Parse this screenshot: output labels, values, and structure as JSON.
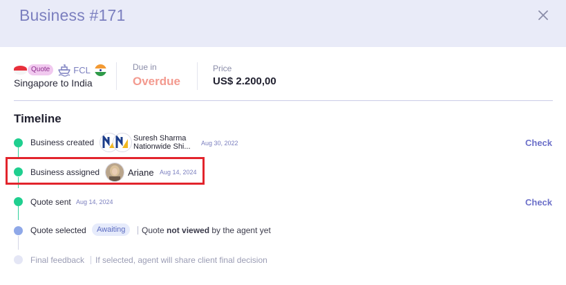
{
  "header": {
    "title": "Business #171"
  },
  "summary": {
    "quote_label": "Quote",
    "mode_label": "FCL",
    "route": "Singapore to India",
    "due_label": "Due in",
    "due_value": "Overdue",
    "price_label": "Price",
    "price_value": "US$ 2.200,00"
  },
  "timeline": {
    "title": "Timeline",
    "steps": [
      {
        "label": "Business created",
        "person_name": "Suresh Sharma",
        "person_company": "Nationwide Shi...",
        "date": "Aug 30, 2022",
        "action": "Check"
      },
      {
        "label": "Business assigned",
        "person_name": "Ariane",
        "date": "Aug 14, 2024"
      },
      {
        "label": "Quote sent",
        "date": "Aug 14, 2024",
        "action": "Check"
      },
      {
        "label": "Quote selected",
        "badge": "Awaiting",
        "note_prefix": "Quote ",
        "note_bold": "not viewed",
        "note_suffix": " by the agent yet"
      },
      {
        "label": "Final feedback",
        "note": "If selected, agent will share client final decision"
      }
    ]
  },
  "colors": {
    "header_bg": "#e9ebf8",
    "accent": "#6c70c9",
    "overdue": "#f39a8f",
    "done_dot": "#1fcf8f",
    "pending_dot": "#8fa8e8",
    "highlight_box": "#e2242c"
  }
}
